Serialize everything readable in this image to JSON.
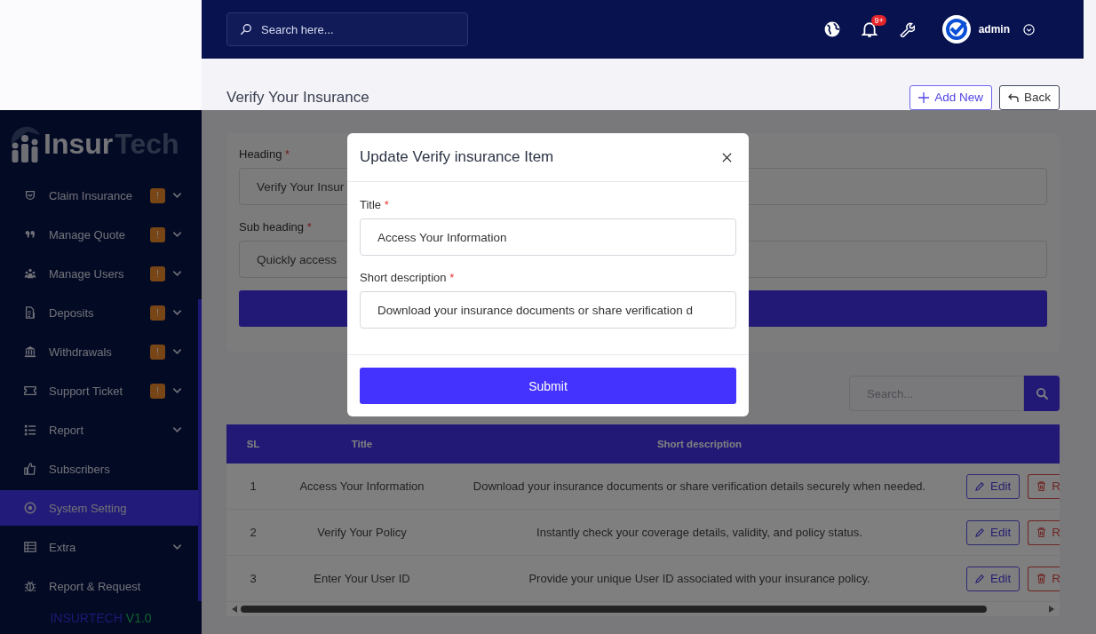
{
  "header": {
    "search": {
      "placeholder": "Search here..."
    },
    "notification_badge": "9+",
    "user": "admin"
  },
  "sidebar": {
    "logo": {
      "primary": "Insur",
      "secondary": "Tech"
    },
    "items": [
      {
        "label": "Claim Insurance",
        "badge": "!",
        "expandable": true,
        "selected": false
      },
      {
        "label": "Manage Quote",
        "badge": "!",
        "expandable": true,
        "selected": false
      },
      {
        "label": "Manage Users",
        "badge": "!",
        "expandable": true,
        "selected": false
      },
      {
        "label": "Deposits",
        "badge": "!",
        "expandable": true,
        "selected": false
      },
      {
        "label": "Withdrawals",
        "badge": "!",
        "expandable": true,
        "selected": false
      },
      {
        "label": "Support Ticket",
        "badge": "!",
        "expandable": true,
        "selected": false
      },
      {
        "label": "Report",
        "expandable": true,
        "selected": false
      },
      {
        "label": "Subscribers",
        "expandable": false,
        "selected": false
      },
      {
        "label": "System Setting",
        "expandable": false,
        "selected": true
      },
      {
        "label": "Extra",
        "expandable": true,
        "selected": false
      },
      {
        "label": "Report & Request",
        "expandable": false,
        "selected": false
      }
    ],
    "footer": {
      "brand": "INSURTECH",
      "version": "V1.0"
    }
  },
  "page": {
    "title": "Verify Your Insurance",
    "actions": [
      {
        "kind": "add",
        "label": "Add New"
      },
      {
        "kind": "back",
        "label": "Back"
      }
    ]
  },
  "form": {
    "fields": [
      {
        "label": "Heading",
        "required_mark": "*",
        "value": "Verify Your Insur"
      },
      {
        "label": "Sub heading",
        "required_mark": "*",
        "value": "Quickly access"
      }
    ]
  },
  "table": {
    "search": {
      "placeholder": "Search..."
    },
    "columns": [
      "SL",
      "Title",
      "Short description"
    ],
    "rows": [
      {
        "sl": "1",
        "title": "Access Your Information",
        "description": "Download your insurance documents or share verification details securely when needed.",
        "actions": [
          {
            "kind": "edit",
            "label": "Edit"
          },
          {
            "kind": "delete",
            "label": "R"
          }
        ]
      },
      {
        "sl": "2",
        "title": "Verify Your Policy",
        "description": "Instantly check your coverage details, validity, and policy status.",
        "actions": [
          {
            "kind": "edit",
            "label": "Edit"
          },
          {
            "kind": "delete",
            "label": "R"
          }
        ]
      },
      {
        "sl": "3",
        "title": "Enter Your User ID",
        "description": "Provide your unique User ID associated with your insurance policy.",
        "actions": [
          {
            "kind": "edit",
            "label": "Edit"
          },
          {
            "kind": "delete",
            "label": "R"
          }
        ]
      }
    ]
  },
  "modal": {
    "title": "Update Verify insurance Item",
    "fields": [
      {
        "label": "Title",
        "required_mark": "*",
        "value": "Access Your Information"
      },
      {
        "label": "Short description",
        "required_mark": "*",
        "value": "Download your insurance documents or share verification d"
      }
    ],
    "submit": "Submit"
  }
}
